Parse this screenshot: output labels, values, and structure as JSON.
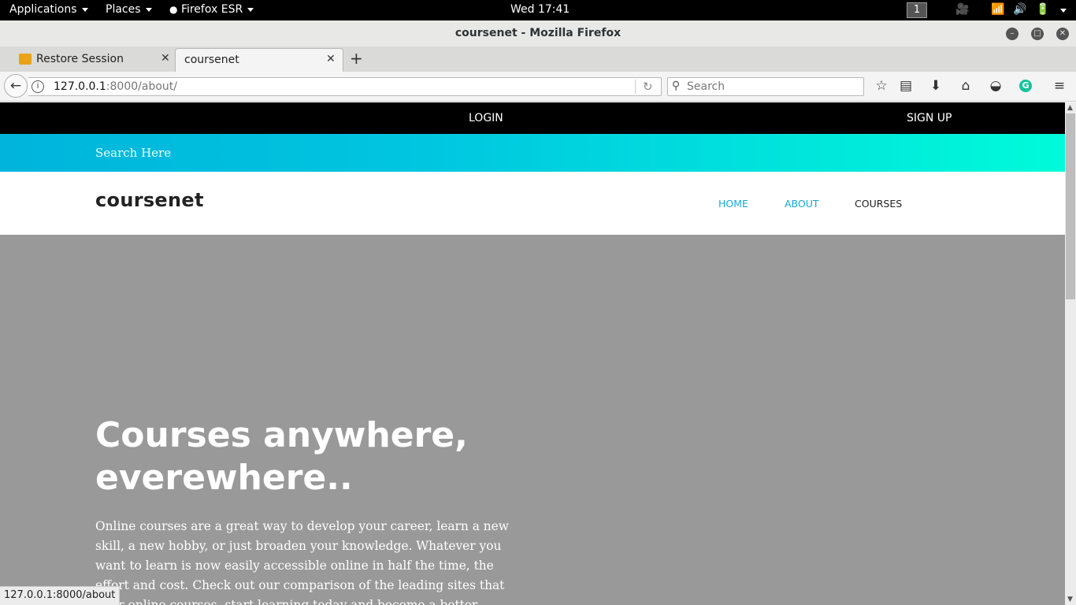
{
  "system_bar": {
    "applications": "Applications",
    "places": "Places",
    "firefox": "Firefox ESR",
    "clock": "Wed 17:41",
    "workspace": "1"
  },
  "window": {
    "title": "coursenet - Mozilla Firefox"
  },
  "tabs": [
    {
      "label": "Restore Session",
      "active": false
    },
    {
      "label": "coursenet",
      "active": true
    }
  ],
  "url": {
    "host": "127.0.0.1",
    "rest": ":8000/about/"
  },
  "search": {
    "placeholder": "Search"
  },
  "site": {
    "top_links": {
      "login": "LOGIN",
      "signup": "SIGN UP"
    },
    "search_placeholder": "Search Here",
    "logo": "coursenet",
    "nav": [
      {
        "label": "HOME",
        "color": "#1aa7d8"
      },
      {
        "label": "ABOUT",
        "color": "#1aa7d8"
      },
      {
        "label": "COURSES",
        "color": "#222222"
      }
    ],
    "hero": {
      "title": "Courses anywhere, everewhere..",
      "body": "Online courses are a great way to develop your career, learn a new skill, a new hobby, or just broaden your knowledge. Whatever you want to learn is now easily accessible online in half the time, the effort and cost. Check out our comparison of the leading sites that offer online courses, start learning today and become a better version of"
    },
    "colors": {
      "gradient_start": "#00b4db",
      "gradient_end": "#00fbd9",
      "hero_bg": "#999999"
    }
  },
  "status_url": "127.0.0.1:8000/about"
}
